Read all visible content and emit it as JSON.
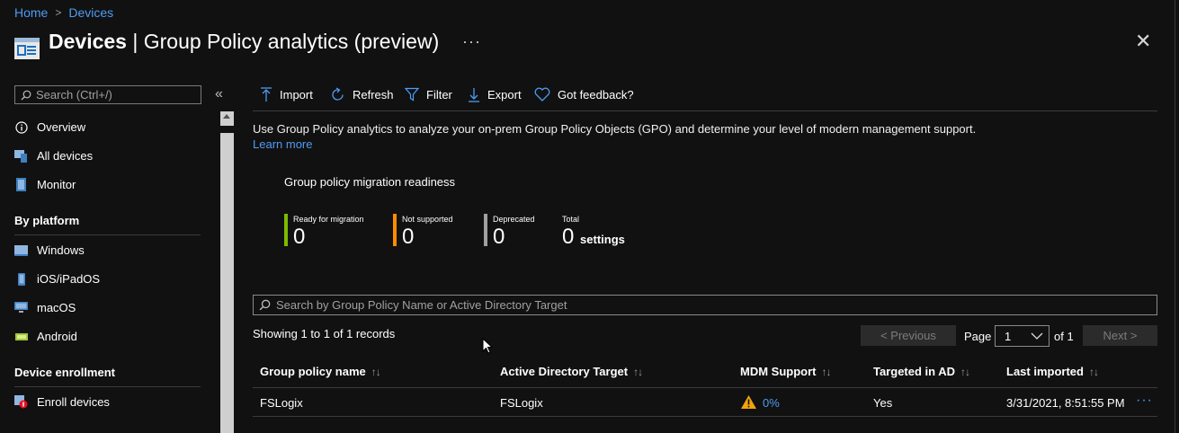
{
  "breadcrumb": {
    "home": "Home",
    "separator": ">",
    "current": "Devices"
  },
  "header": {
    "title_bold": "Devices",
    "title_rest": " | Group Policy analytics (preview)",
    "more": "···",
    "close": "✕"
  },
  "sidebar": {
    "search_placeholder": "Search (Ctrl+/)",
    "collapse": "«",
    "items_top": [
      {
        "label": "Overview",
        "icon": "info-icon"
      },
      {
        "label": "All devices",
        "icon": "devices-icon"
      },
      {
        "label": "Monitor",
        "icon": "monitor-book-icon"
      }
    ],
    "section_platform": "By platform",
    "items_platform": [
      {
        "label": "Windows",
        "icon": "windows-icon"
      },
      {
        "label": "iOS/iPadOS",
        "icon": "phone-icon"
      },
      {
        "label": "macOS",
        "icon": "desktop-icon"
      },
      {
        "label": "Android",
        "icon": "android-icon"
      }
    ],
    "section_enrollment": "Device enrollment",
    "items_enrollment": [
      {
        "label": "Enroll devices",
        "icon": "enroll-icon"
      }
    ]
  },
  "toolbar": {
    "import": "Import",
    "refresh": "Refresh",
    "filter": "Filter",
    "export": "Export",
    "feedback": "Got feedback?"
  },
  "intro": {
    "description": "Use Group Policy analytics to analyze your on-prem Group Policy Objects (GPO) and determine your level of modern management support.",
    "learn_more": "Learn more"
  },
  "readiness": {
    "title": "Group policy migration readiness",
    "metrics": [
      {
        "label": "Ready for migration",
        "value": "0",
        "color": "#7fba00"
      },
      {
        "label": "Not supported",
        "value": "0",
        "color": "#ff8c00"
      },
      {
        "label": "Deprecated",
        "value": "0",
        "color": "#a0a0a0"
      },
      {
        "label": "Total",
        "value": "0",
        "unit": "settings"
      }
    ]
  },
  "grid": {
    "search_placeholder": "Search by Group Policy Name or Active Directory Target",
    "records": "Showing 1 to 1 of 1 records",
    "previous": "< Previous",
    "page_label": "Page",
    "page_value": "1",
    "of_label": "of 1",
    "next": "Next >",
    "columns": [
      "Group policy name",
      "Active Directory Target",
      "MDM Support",
      "Targeted in AD",
      "Last imported"
    ],
    "sort_glyph": "↑↓",
    "rows": [
      {
        "name": "FSLogix",
        "target": "FSLogix",
        "mdm": "0%",
        "targeted": "Yes",
        "imported": "3/31/2021, 8:51:55 PM",
        "more": "···"
      }
    ]
  },
  "colors": {
    "link": "#4f9cf5",
    "background": "#111111",
    "warning": "#f0a30a"
  }
}
